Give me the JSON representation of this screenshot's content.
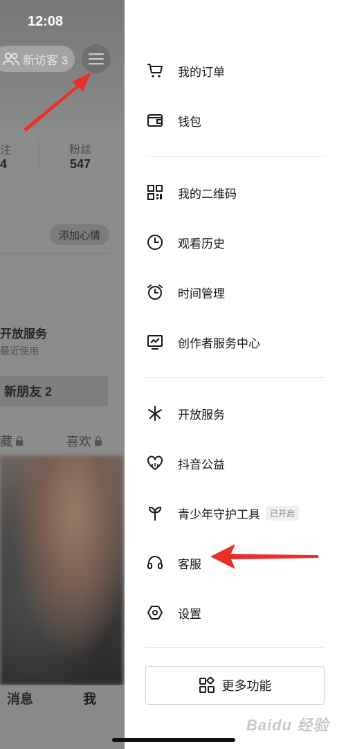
{
  "status_bar": {
    "time": "12:08"
  },
  "background_profile": {
    "visitor_label": "新访客 3",
    "stats": [
      {
        "label": "注",
        "value": "4"
      },
      {
        "label": "粉丝",
        "value": "547"
      }
    ],
    "add_mood": "添加心情",
    "open_service": {
      "title": "开放服务",
      "subtitle": "最近使用"
    },
    "new_friends": "新朋友 2",
    "tabs": [
      {
        "label": "藏"
      },
      {
        "label": "喜欢"
      }
    ],
    "bottom_nav": [
      {
        "label": "消息"
      },
      {
        "label": "我"
      }
    ]
  },
  "drawer": {
    "groups": [
      [
        {
          "id": "orders",
          "icon": "cart-icon",
          "label": "我的订单"
        },
        {
          "id": "wallet",
          "icon": "wallet-icon",
          "label": "钱包"
        }
      ],
      [
        {
          "id": "qrcode",
          "icon": "qrcode-icon",
          "label": "我的二维码"
        },
        {
          "id": "history",
          "icon": "clock-icon",
          "label": "观看历史"
        },
        {
          "id": "time",
          "icon": "alarm-icon",
          "label": "时间管理"
        },
        {
          "id": "creator",
          "icon": "chart-monitor-icon",
          "label": "创作者服务中心"
        }
      ],
      [
        {
          "id": "open",
          "icon": "asterisk-icon",
          "label": "开放服务"
        },
        {
          "id": "charity",
          "icon": "heart-icon",
          "label": "抖音公益"
        },
        {
          "id": "youth",
          "icon": "sprout-icon",
          "label": "青少年守护工具",
          "badge": "已开启"
        },
        {
          "id": "service",
          "icon": "headset-icon",
          "label": "客服"
        },
        {
          "id": "settings",
          "icon": "hexagon-settings-icon",
          "label": "设置"
        }
      ]
    ],
    "more_button": "更多功能"
  },
  "watermark": "Baidu 经验"
}
